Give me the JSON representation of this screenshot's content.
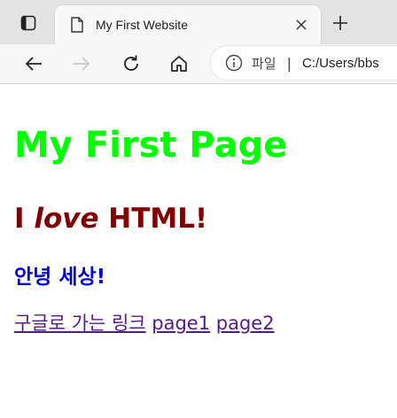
{
  "browser": {
    "tab": {
      "title": "My First Website"
    },
    "address": {
      "scheme": "파일",
      "separator": "|",
      "url": "C:/Users/bbs"
    }
  },
  "page": {
    "heading": "My First Page",
    "love": {
      "prefix": "I ",
      "emphasis": "love",
      "suffix": " HTML!"
    },
    "hello": "안녕 세상!",
    "links": [
      "구글로 가는 링크",
      "page1",
      "page2"
    ]
  },
  "colors": {
    "heading": "#00ff00",
    "love": "#800000",
    "hello": "#0000dd",
    "link_visited": "#551a8b"
  }
}
